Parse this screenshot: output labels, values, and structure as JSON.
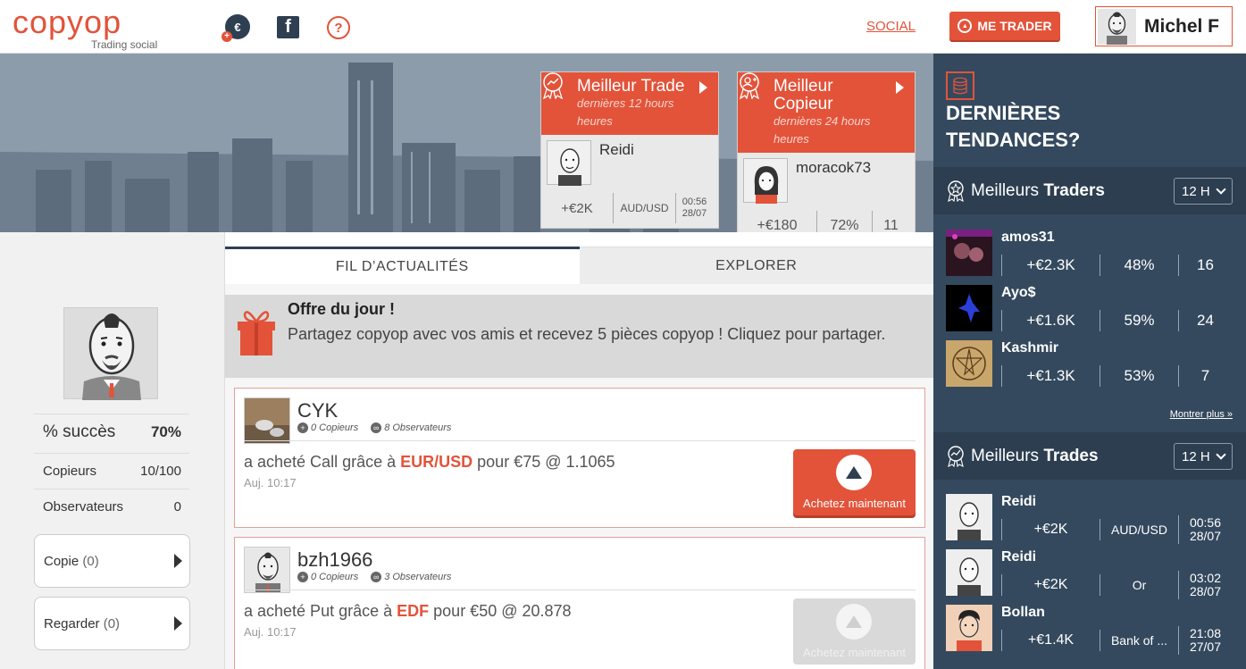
{
  "header": {
    "logo": "copyop",
    "logo_sub": "Trading social",
    "coin_symbol": "€",
    "coin_plus": "+",
    "fb_letter": "f",
    "help_glyph": "?",
    "social_link": "SOCIAL",
    "me_trader": "ME TRADER",
    "user_name": "Michel F",
    "icons": [
      "coin-add-icon",
      "facebook-icon",
      "help-icon",
      "arrow-up-circle-icon"
    ]
  },
  "best_trade": {
    "title": "Meilleur Trade",
    "subtitle": "dernières 12 hours heures",
    "name": "Reidi",
    "profit": "+€2K",
    "asset": "AUD/USD",
    "time": "00:56",
    "date": "28/07"
  },
  "best_copier": {
    "title": "Meilleur Copieur",
    "subtitle": "dernières 24 hours heures",
    "name": "moracok73",
    "profit": "+€180",
    "pct": "72%",
    "count": "11"
  },
  "profile": {
    "success_label": "% succès",
    "success_value": "70%",
    "copiers_label": "Copieurs",
    "copiers_value": "10/100",
    "watchers_label": "Observateurs",
    "watchers_value": "0",
    "copy_btn": "Copie",
    "copy_count": "(0)",
    "watch_btn": "Regarder",
    "watch_count": "(0)"
  },
  "tabs": {
    "news": "FIL D’ACTUALITÉS",
    "explore": "EXPLORER"
  },
  "offer": {
    "title": "Offre du jour !",
    "text": "Partagez copyop avec vos amis et recevez 5 pièces copyop ! Cliquez pour partager."
  },
  "feed": [
    {
      "name": "CYK",
      "copiers": "0 Copieurs",
      "observers": "8 Observateurs",
      "action": "a acheté Call grâce à",
      "asset": "EUR/USD",
      "detail": "pour €75 @ 1.1065",
      "time": "Auj. 10:17",
      "button": "Achetez maintenant"
    },
    {
      "name": "bzh1966",
      "copiers": "0 Copieurs",
      "observers": "3 Observateurs",
      "action": "a acheté Put grâce à",
      "asset": "EDF",
      "detail": "pour €50 @ 20.878",
      "time": "Auj. 10:17",
      "button": "Achetez maintenant"
    }
  ],
  "sidebar": {
    "trend_title": "DERNIÈRES TENDANCES?",
    "traders_head_pre": "Meilleurs",
    "traders_head_bold": "Traders",
    "traders_period": "12 H",
    "traders": [
      {
        "name": "amos31",
        "profit": "+€2.3K",
        "pct": "48%",
        "count": "16"
      },
      {
        "name": "Ayo$",
        "profit": "+€1.6K",
        "pct": "59%",
        "count": "24"
      },
      {
        "name": "Kashmir",
        "profit": "+€1.3K",
        "pct": "53%",
        "count": "7"
      }
    ],
    "more": "Montrer plus »",
    "trades_head_pre": "Meilleurs",
    "trades_head_bold": "Trades",
    "trades_period": "12 H",
    "trades": [
      {
        "name": "Reidi",
        "profit": "+€2K",
        "asset": "AUD/USD",
        "time": "00:56",
        "date": "28/07"
      },
      {
        "name": "Reidi",
        "profit": "+€2K",
        "asset": "Or",
        "time": "03:02",
        "date": "28/07"
      },
      {
        "name": "Bollan",
        "profit": "+€1.4K",
        "asset": "Bank of ...",
        "time": "21:08",
        "date": "27/07"
      }
    ]
  },
  "colors": {
    "accent": "#e2533a",
    "dark": "#34495e",
    "dark_head": "#2c3e50"
  }
}
